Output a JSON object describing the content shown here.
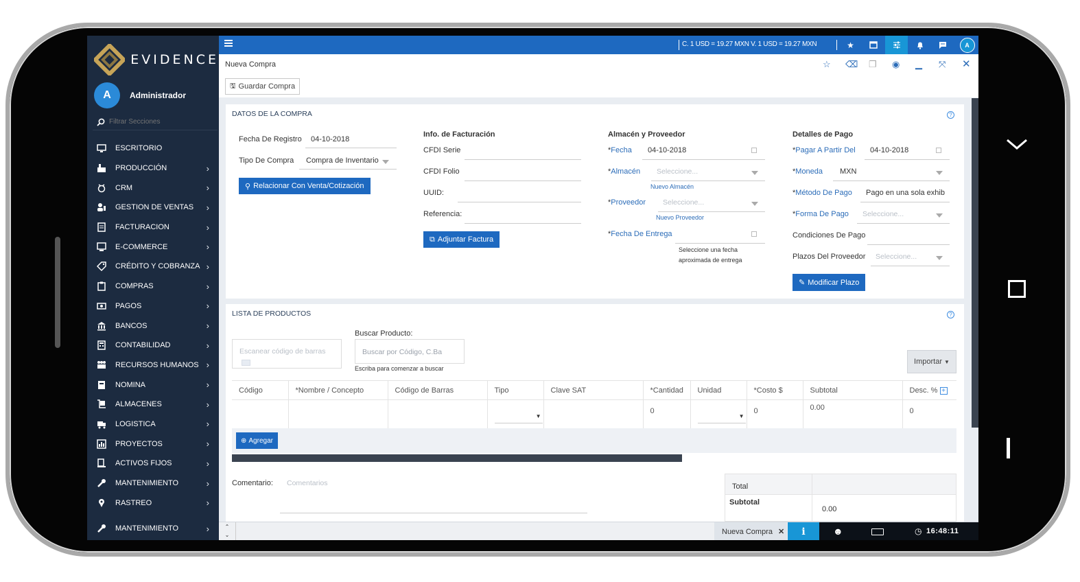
{
  "sidebar": {
    "brand": "EVIDENCE",
    "user": {
      "initial": "A",
      "name": "Administrador"
    },
    "filter_placeholder": "Filtrar Secciones",
    "items": [
      {
        "label": "ESCRITORIO",
        "icon": "desktop-icon",
        "chevron": false
      },
      {
        "label": "PRODUCCIÓN",
        "icon": "factory-icon",
        "chevron": true
      },
      {
        "label": "CRM",
        "icon": "handshake-icon",
        "chevron": true
      },
      {
        "label": "GESTION DE VENTAS",
        "icon": "users-sales-icon",
        "chevron": true
      },
      {
        "label": "FACTURACION",
        "icon": "invoice-icon",
        "chevron": true
      },
      {
        "label": "E-COMMERCE",
        "icon": "monitor-cart-icon",
        "chevron": true
      },
      {
        "label": "CRÉDITO Y COBRANZA",
        "icon": "tag-dollar-icon",
        "chevron": true
      },
      {
        "label": "COMPRAS",
        "icon": "clipboard-icon",
        "chevron": true
      },
      {
        "label": "PAGOS",
        "icon": "money-icon",
        "chevron": true
      },
      {
        "label": "BANCOS",
        "icon": "bank-icon",
        "chevron": true
      },
      {
        "label": "CONTABILIDAD",
        "icon": "calculator-icon",
        "chevron": true
      },
      {
        "label": "RECURSOS HUMANOS",
        "icon": "people-icon",
        "chevron": true
      },
      {
        "label": "NOMINA",
        "icon": "payroll-icon",
        "chevron": true
      },
      {
        "label": "ALMACENES",
        "icon": "dolly-icon",
        "chevron": true
      },
      {
        "label": "LOGISTICA",
        "icon": "truck-icon",
        "chevron": true
      },
      {
        "label": "PROYECTOS",
        "icon": "chart-icon",
        "chevron": true
      },
      {
        "label": "ACTIVOS FIJOS",
        "icon": "asset-icon",
        "chevron": true
      },
      {
        "label": "MANTENIMIENTO",
        "icon": "wrench-icon",
        "chevron": true
      },
      {
        "label": "RASTREO",
        "icon": "map-pin-icon",
        "chevron": true
      }
    ],
    "bottom_item": {
      "label": "MANTENIMIENTO",
      "icon": "wrench-icon"
    }
  },
  "topbar": {
    "exchange_rate": "C. 1 USD = 19.27 MXN   V. 1 USD = 19.27 MXN",
    "avatar_initial": "A"
  },
  "window": {
    "title": "Nueva Compra",
    "save_button": "Guardar Compra"
  },
  "datos": {
    "heading": "DATOS DE LA COMPRA",
    "fecha_registro_label": "Fecha De Registro",
    "fecha_registro_value": "04-10-2018",
    "tipo_compra_label": "Tipo De Compra",
    "tipo_compra_value": "Compra de Inventario",
    "relacionar_button": "Relacionar Con Venta/Cotización",
    "facturacion": {
      "heading": "Info. de Facturación",
      "cfdi_serie": "CFDI Serie",
      "cfdi_folio": "CFDI Folio",
      "uuid": "UUID:",
      "referencia": "Referencia:",
      "adjuntar_button": "Adjuntar Factura"
    },
    "almacen": {
      "heading": "Almacén y Proveedor",
      "fecha_label": "Fecha",
      "fecha_value": "04-10-2018",
      "almacen_label": "Almacén",
      "almacen_placeholder": "Seleccione...",
      "nuevo_almacen": "Nuevo Almacén",
      "proveedor_label": "Proveedor",
      "proveedor_placeholder": "Seleccione...",
      "nuevo_proveedor": "Nuevo Proveedor",
      "fecha_entrega_label": "Fecha De Entrega",
      "fecha_entrega_hint_1": "Seleccione una fecha",
      "fecha_entrega_hint_2": "aproximada de entrega"
    },
    "pago": {
      "heading": "Detalles de Pago",
      "pagar_label": "Pagar A Partir Del",
      "pagar_value": "04-10-2018",
      "moneda_label": "Moneda",
      "moneda_value": "MXN",
      "metodo_label": "Método De Pago",
      "metodo_value": "Pago en una sola exhibi",
      "forma_label": "Forma De Pago",
      "forma_placeholder": "Seleccione...",
      "condiciones_label": "Condiciones De Pago",
      "plazos_label": "Plazos Del Proveedor",
      "plazos_placeholder": "Seleccione...",
      "modificar_button": "Modificar Plazo"
    }
  },
  "productos": {
    "heading": "LISTA DE PRODUCTOS",
    "barcode_placeholder": "Escanear código de barras",
    "buscar_label": "Buscar Producto:",
    "buscar_placeholder": "Buscar por Código, C.Ba",
    "buscar_hint": "Escriba para comenzar a buscar",
    "importar_button": "Importar",
    "columns": [
      "Código",
      "*Nombre / Concepto",
      "Código de Barras",
      "Tipo",
      "Clave SAT",
      "*Cantidad",
      "Unidad",
      "*Costo $",
      "Subtotal",
      "Desc. %"
    ],
    "row": {
      "cantidad": "0",
      "costo": "0",
      "subtotal": "0.00",
      "desc": "0"
    },
    "agregar_button": "Agregar",
    "comentario_label": "Comentario:",
    "comentario_placeholder": "Comentarios",
    "totals": {
      "total_label": "Total",
      "subtotal_label": "Subtotal",
      "subtotal_value": "0.00"
    }
  },
  "statusbar": {
    "tab_label": "Nueva Compra",
    "clock": "16:48:11"
  },
  "colors": {
    "sidebar": "#1c2b40",
    "topbar": "#1e69c0",
    "accent": "#1896d6"
  }
}
